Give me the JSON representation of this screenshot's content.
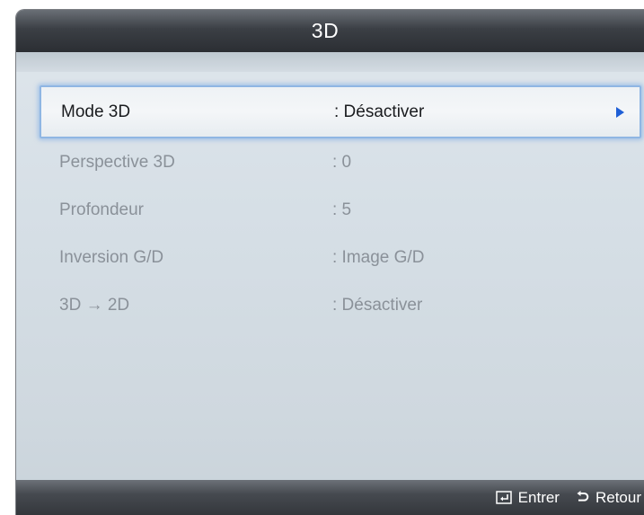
{
  "window": {
    "title": "3D"
  },
  "menu": {
    "items": [
      {
        "label": "Mode 3D",
        "value": ": Désactiver",
        "state": "selected",
        "has_submenu": true
      },
      {
        "label": "Perspective 3D",
        "value": ": 0",
        "state": "disabled"
      },
      {
        "label": "Profondeur",
        "value": ": 5",
        "state": "disabled"
      },
      {
        "label": "Inversion G/D",
        "value": ": Image G/D",
        "state": "disabled"
      },
      {
        "label": "3D → 2D",
        "value": ": Désactiver",
        "state": "disabled"
      }
    ]
  },
  "footer": {
    "enter": {
      "label": "Entrer",
      "icon": "enter-icon"
    },
    "back": {
      "label": "Retour",
      "icon": "return-icon"
    }
  },
  "colors": {
    "titlebar": "#2b2e33",
    "selection_border": "#8fb6e3",
    "arrow": "#1f5fd6",
    "disabled_text": "#8a9199"
  }
}
